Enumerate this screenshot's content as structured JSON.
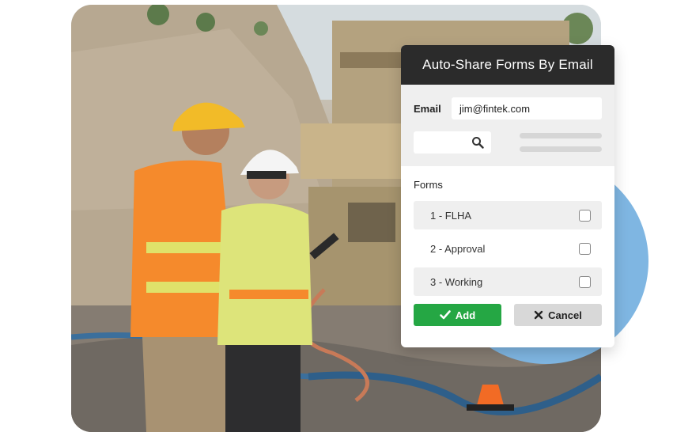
{
  "dialog": {
    "title": "Auto-Share Forms By Email",
    "email_label": "Email",
    "email_value": "jim@fintek.com",
    "search_icon": "search-icon",
    "forms_title": "Forms",
    "forms": [
      {
        "label": "1 - FLHA",
        "checked": false
      },
      {
        "label": "2 - Approval",
        "checked": false
      },
      {
        "label": "3 - Working",
        "checked": false
      }
    ],
    "add_label": "Add",
    "add_icon": "check-icon",
    "cancel_label": "Cancel",
    "cancel_icon": "x-icon"
  },
  "colors": {
    "header": "#2b2b2b",
    "add": "#25a744",
    "cancel": "#d8d8d8",
    "accent_circle": "#7fb6e2"
  }
}
